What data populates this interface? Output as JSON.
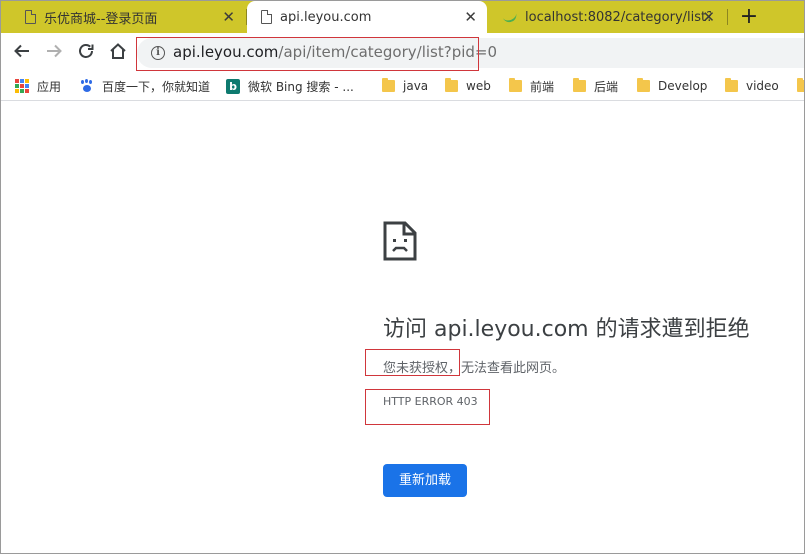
{
  "tabs": [
    {
      "title": "乐优商城--登录页面",
      "close": "✕"
    },
    {
      "title": "api.leyou.com",
      "close": "✕"
    },
    {
      "title": "localhost:8082/category/list?p",
      "close": "✕"
    }
  ],
  "new_tab": "+",
  "address_bar": {
    "host": "api.leyou.com",
    "path": "/api/item/category/list?pid=0",
    "info_glyph": "i"
  },
  "bookmarks": [
    {
      "label": "应用",
      "icon": "apps-grid-icon"
    },
    {
      "label": "百度一下，你就知道",
      "icon": "baidu-paw-icon"
    },
    {
      "label": "微软 Bing 搜索 - ...",
      "icon": "bing-icon",
      "glyph": "b"
    },
    {
      "label": "java",
      "icon": "folder-icon"
    },
    {
      "label": "web",
      "icon": "folder-icon"
    },
    {
      "label": "前端",
      "icon": "folder-icon"
    },
    {
      "label": "后端",
      "icon": "folder-icon"
    },
    {
      "label": "Develop",
      "icon": "folder-icon"
    },
    {
      "label": "video",
      "icon": "folder-icon"
    }
  ],
  "error": {
    "title_prefix": "访问 ",
    "title_host": "api.leyou.com",
    "title_suffix": " 的请求遭到拒绝",
    "desc_highlight": "您未获授权",
    "desc_rest": "，无法查看此网页。",
    "code": "HTTP ERROR 403",
    "reload_label": "重新加载"
  },
  "colors": {
    "tabstrip": "#cfc62a",
    "reload_button": "#1a73e8",
    "highlight_box": "#d0363b",
    "folder": "#f4c64b"
  }
}
